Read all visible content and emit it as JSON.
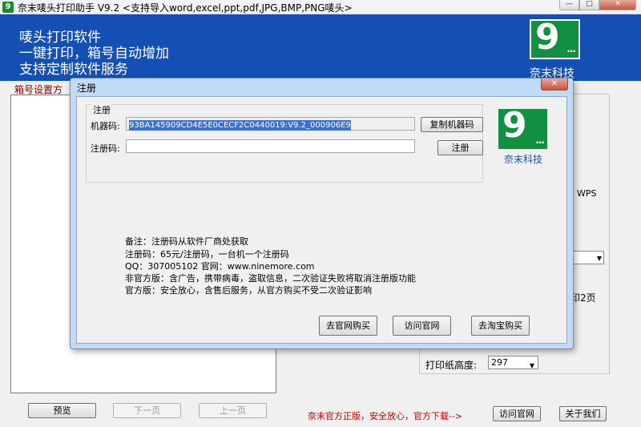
{
  "window": {
    "title": "奈末唛头打印助手  V9.2    <支持导入word,excel,ppt,pdf,JPG,BMP,PNG唛头>",
    "icon_name": "app-icon",
    "icon_text": "9",
    "min_glyph": "—",
    "max_glyph": "□",
    "close_glyph": "✕"
  },
  "banner": {
    "line1": "唛头打印软件",
    "line2": "一键打印，箱号自动增加",
    "line3": "支持定制软件服务",
    "logo_nine": "9",
    "logo_dots": "...",
    "company": "奈末科技"
  },
  "main": {
    "group_label": "箱号设置方",
    "wps_label": "WPS",
    "print2_label": "印2页",
    "paper_height_label": "打印纸高度:",
    "paper_height_value": "297",
    "combo_arrow": "▼"
  },
  "footer": {
    "preview": "预览",
    "next": "下一页",
    "prev": "上一页",
    "notice": "奈末官方正版，安全放心，官方下载-->",
    "visit": "访问官网",
    "about": "关于我们"
  },
  "dialog": {
    "title": "注册",
    "close_glyph": "✕",
    "group_title": "注册",
    "machine_label": "机器码:",
    "machine_code": "93BA145909CD4E5E0CECF2C0440019:V9.2_000906E9",
    "copy_button": "复制机器码",
    "regcode_label": "注册码:",
    "regcode_value": "",
    "register_button": "注册",
    "logo_nine": "9",
    "logo_dots": "...",
    "company": "奈末科技",
    "notes": [
      "备注：注册码从软件厂商处获取",
      "注册码：65元/注册码，一台机一个注册码",
      "QQ：307005102 官网：www.ninemore.com",
      "非官方版：含广告，携带病毒，盗取信息，二次验证失败将取消注册版功能",
      "官方版：安全放心，含售后服务，从官方购买不受二次验证影响"
    ],
    "buy_site_button": "去官网购买",
    "visit_site_button": "访问官网",
    "taobao_button": "去淘宝购买"
  },
  "colors": {
    "banner_bg": "#1450b4",
    "logo_green": "#109040",
    "footer_red": "#c00000",
    "dialog_frame": "#c2daf3"
  }
}
